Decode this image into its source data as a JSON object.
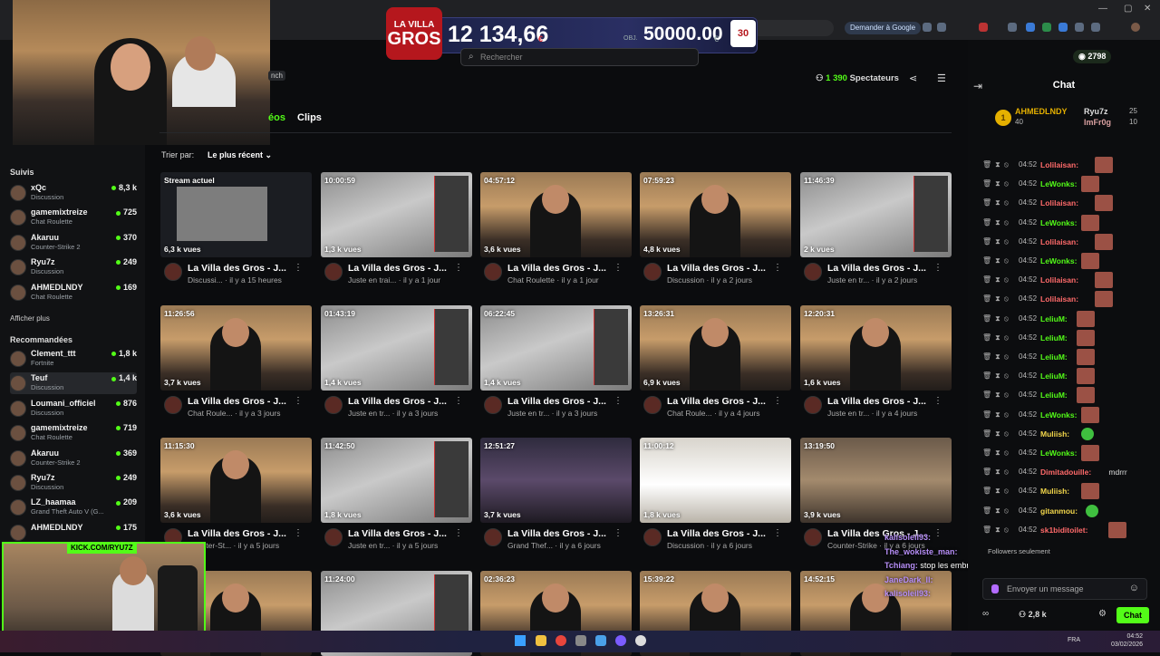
{
  "browser": {
    "ask_google": "Demander à Google"
  },
  "banner": {
    "logo_line1": "LA VILLA",
    "logo_line2": "GROS",
    "amount": "12 134,66",
    "amount_currency": "€",
    "objective_label": "OBJ.",
    "goal": "50000.00",
    "goal_currency": "€",
    "badge": "30"
  },
  "search": {
    "placeholder": "Rechercher"
  },
  "channel": {
    "tag": "nch",
    "viewers_count": "1 390",
    "viewers_label": "Spectateurs",
    "tabs": [
      {
        "label": "éos"
      },
      {
        "label": "Clips"
      }
    ],
    "sort_label": "Trier par:",
    "sort_value": "Le plus récent"
  },
  "sidebar": {
    "followed_title": "Suivis",
    "followed": [
      {
        "name": "xQc",
        "category": "Discussion",
        "viewers": "8,3 k"
      },
      {
        "name": "gamemixtreize",
        "category": "Chat Roulette",
        "viewers": "725"
      },
      {
        "name": "Akaruu",
        "category": "Counter-Strike 2",
        "viewers": "370"
      },
      {
        "name": "Ryu7z",
        "category": "Discussion",
        "viewers": "249"
      },
      {
        "name": "AHMEDLNDY",
        "category": "Chat Roulette",
        "viewers": "169"
      }
    ],
    "show_more": "Afficher plus",
    "recommended_title": "Recommandées",
    "recommended": [
      {
        "name": "Clement_ttt",
        "category": "Fortnite",
        "viewers": "1,8 k"
      },
      {
        "name": "Teuf",
        "category": "Discussion",
        "viewers": "1,4 k"
      },
      {
        "name": "Loumani_officiel",
        "category": "Discussion",
        "viewers": "876"
      },
      {
        "name": "gamemixtreize",
        "category": "Chat Roulette",
        "viewers": "719"
      },
      {
        "name": "Akaruu",
        "category": "Counter-Strike 2",
        "viewers": "369"
      },
      {
        "name": "Ryu7z",
        "category": "Discussion",
        "viewers": "249"
      },
      {
        "name": "LZ_haamaa",
        "category": "Grand Theft Auto V (G...",
        "viewers": "209"
      },
      {
        "name": "AHMEDLNDY",
        "category": "",
        "viewers": "175"
      }
    ]
  },
  "webcam": {
    "tag": "KICK.COM/RYU7Z"
  },
  "videos": [
    {
      "duration": "Stream actuel",
      "views": "6,3 k vues",
      "title": "La Villa des Gros - J...",
      "meta": "Discussi... · il y a 15 heures",
      "style": "stream"
    },
    {
      "duration": "10:00:59",
      "views": "1,3 k vues",
      "title": "La Villa des Gros - J...",
      "meta": "Juste en trai... · il y a 1 jour",
      "style": "bed"
    },
    {
      "duration": "04:57:12",
      "views": "3,6 k vues",
      "title": "La Villa des Gros - J...",
      "meta": "Chat Roulette · il y a 1 jour",
      "style": "room"
    },
    {
      "duration": "07:59:23",
      "views": "4,8 k vues",
      "title": "La Villa des Gros - J...",
      "meta": "Discussion · il y a 2 jours",
      "style": "room"
    },
    {
      "duration": "11:46:39",
      "views": "2 k vues",
      "title": "La Villa des Gros - J...",
      "meta": "Juste en tr... · il y a 2 jours",
      "style": "bed"
    },
    {
      "duration": "11:26:56",
      "views": "3,7 k vues",
      "title": "La Villa des Gros - J...",
      "meta": "Chat Roule... · il y a 3 jours",
      "style": "room"
    },
    {
      "duration": "01:43:19",
      "views": "1,4 k vues",
      "title": "La Villa des Gros - J...",
      "meta": "Juste en tr... · il y a 3 jours",
      "style": "bed"
    },
    {
      "duration": "06:22:45",
      "views": "1,4 k vues",
      "title": "La Villa des Gros - J...",
      "meta": "Juste en tr... · il y a 3 jours",
      "style": "bed"
    },
    {
      "duration": "13:26:31",
      "views": "6,9 k vues",
      "title": "La Villa des Gros - J...",
      "meta": "Chat Roule... · il y a 4 jours",
      "style": "room"
    },
    {
      "duration": "12:20:31",
      "views": "1,6 k vues",
      "title": "La Villa des Gros - J...",
      "meta": "Juste en tr... · il y a 4 jours",
      "style": "room"
    },
    {
      "duration": "11:15:30",
      "views": "3,6 k vues",
      "title": "La Villa des Gros - J...",
      "meta": "Counter-St... · il y a 5 jours",
      "style": "room"
    },
    {
      "duration": "11:42:50",
      "views": "1,8 k vues",
      "title": "La Villa des Gros - J...",
      "meta": "Juste en tr... · il y a 5 jours",
      "style": "bed"
    },
    {
      "duration": "12:51:27",
      "views": "3,7 k vues",
      "title": "La Villa des Gros - J...",
      "meta": "Grand Thef... · il y a 6 jours",
      "style": "dark"
    },
    {
      "duration": "11:00:12",
      "views": "1,8 k vues",
      "title": "La Villa des Gros - J...",
      "meta": "Discussion · il y a 6 jours",
      "style": "kitchen"
    },
    {
      "duration": "13:19:50",
      "views": "3,9 k vues",
      "title": "La Villa des Gros - J...",
      "meta": "Counter-Strike · il y a 6 jours",
      "style": "game"
    },
    {
      "duration": "",
      "views": "",
      "title": "",
      "meta": "",
      "style": "room"
    },
    {
      "duration": "11:24:00",
      "views": "",
      "title": "",
      "meta": "",
      "style": "bed"
    },
    {
      "duration": "02:36:23",
      "views": "",
      "title": "",
      "meta": "",
      "style": "room"
    },
    {
      "duration": "15:39:22",
      "views": "",
      "title": "",
      "meta": "",
      "style": "room"
    },
    {
      "duration": "14:52:15",
      "views": "",
      "title": "",
      "meta": "",
      "style": "room"
    }
  ],
  "chat": {
    "title": "Chat",
    "credits": "2798",
    "top_gifters": {
      "first_name": "AHMEDLNDY",
      "first_count": "40",
      "second_name": "Ryu7z",
      "second_count": "25",
      "third_name": "ImFr0g",
      "third_count": "10"
    },
    "messages": [
      {
        "time": "04:52",
        "user": "Lolilaisan:",
        "color": "#ff6a6a",
        "text": "",
        "emote": true
      },
      {
        "time": "04:52",
        "user": "LeWonks:",
        "color": "#53fc18",
        "text": "",
        "emote": true
      },
      {
        "time": "04:52",
        "user": "Lolilaisan:",
        "color": "#ff6a6a",
        "text": "",
        "emote": true
      },
      {
        "time": "04:52",
        "user": "LeWonks:",
        "color": "#53fc18",
        "text": "",
        "emote": true
      },
      {
        "time": "04:52",
        "user": "Lolilaisan:",
        "color": "#ff6a6a",
        "text": "",
        "emote": true
      },
      {
        "time": "04:52",
        "user": "LeWonks:",
        "color": "#53fc18",
        "text": "",
        "emote": true
      },
      {
        "time": "04:52",
        "user": "Lolilaisan:",
        "color": "#ff6a6a",
        "text": "",
        "emote": true
      },
      {
        "time": "04:52",
        "user": "Lolilaisan:",
        "color": "#ff6a6a",
        "text": "",
        "emote": true
      },
      {
        "time": "04:52",
        "user": "LeliuM:",
        "color": "#53fc18",
        "text": "",
        "emote": true
      },
      {
        "time": "04:52",
        "user": "LeliuM:",
        "color": "#53fc18",
        "text": "",
        "emote": true
      },
      {
        "time": "04:52",
        "user": "LeliuM:",
        "color": "#53fc18",
        "text": "",
        "emote": true
      },
      {
        "time": "04:52",
        "user": "LeliuM:",
        "color": "#53fc18",
        "text": "",
        "emote": true
      },
      {
        "time": "04:52",
        "user": "LeliuM:",
        "color": "#53fc18",
        "text": "",
        "emote": true
      },
      {
        "time": "04:52",
        "user": "LeWonks:",
        "color": "#53fc18",
        "text": "",
        "emote": true
      },
      {
        "time": "04:52",
        "user": "Muliish:",
        "color": "#f2d64b",
        "text": "",
        "emote": "green"
      },
      {
        "time": "04:52",
        "user": "LeWonks:",
        "color": "#53fc18",
        "text": "",
        "emote": true
      },
      {
        "time": "04:52",
        "user": "Dimitadouille:",
        "color": "#ff6a6a",
        "text": "mdrrr",
        "emote": false
      },
      {
        "time": "04:52",
        "user": "Muliish:",
        "color": "#f2d64b",
        "text": "",
        "emote": true
      },
      {
        "time": "04:52",
        "user": "gitanmou:",
        "color": "#f2d64b",
        "text": "",
        "emote": "green"
      },
      {
        "time": "04:52",
        "user": "sk1biditoilet:",
        "color": "#ff6a6a",
        "text": "",
        "emote": true
      }
    ],
    "overlay": [
      {
        "user": "kalisoleil93:",
        "text": ""
      },
      {
        "user": "The_wokiste_man:",
        "text": ""
      },
      {
        "user": "Tchiang:",
        "text": "stop les embrouilles svp"
      },
      {
        "user": "JaneDark_ll:",
        "text": ""
      },
      {
        "user": "kalisoleil93:",
        "text": ""
      }
    ],
    "followers_only": "Followers seulement",
    "input_placeholder": "Envoyer un message",
    "viewer_count": "2,8 k",
    "send_label": "Chat"
  },
  "taskbar": {
    "lang": "FRA",
    "time": "04:52",
    "date": "03/02/2026"
  }
}
